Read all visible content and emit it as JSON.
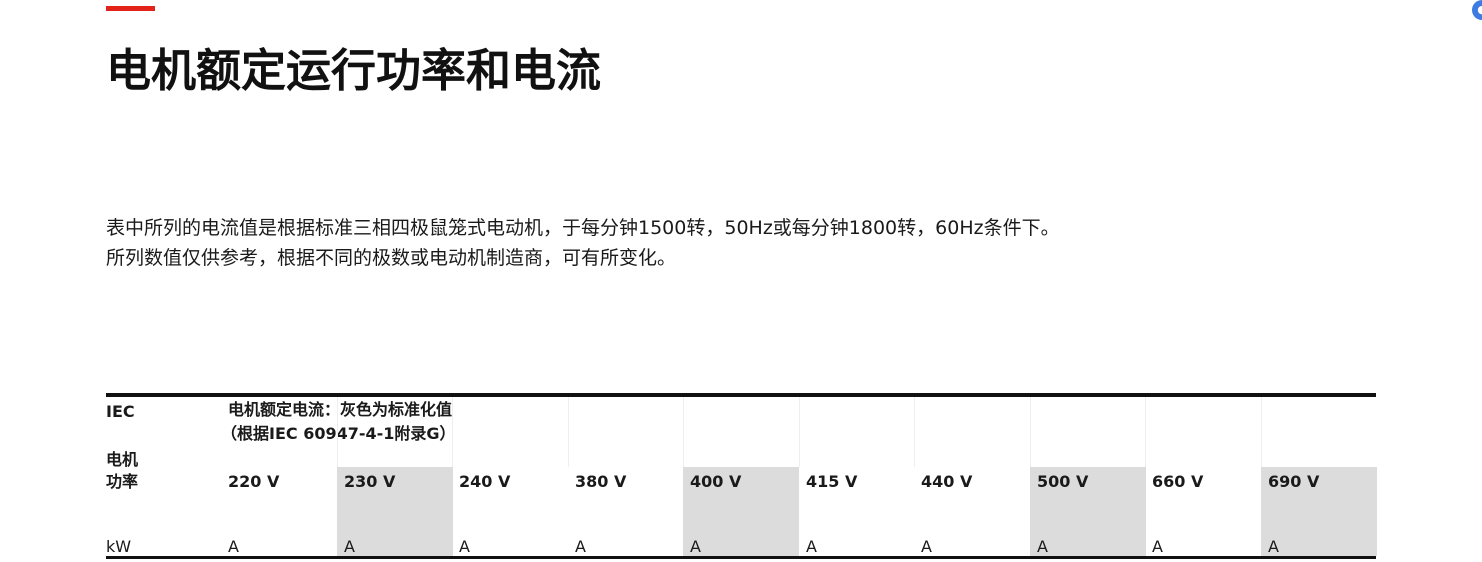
{
  "colors": {
    "accent": "#e2231a",
    "shade": "#dcdcdc"
  },
  "title": "电机额定运行功率和电流",
  "intro": {
    "line1": "表中所列的电流值是根据标准三相四极鼠笼式电动机，于每分钟1500转，50Hz或每分钟1800转，60Hz条件下。",
    "line2": "所列数值仅供参考，根据不同的极数或电动机制造商，可有所变化。"
  },
  "table": {
    "iec_label": "IEC",
    "motor_label_1": "电机",
    "motor_label_2": "功率",
    "current_header": "电机额定电流：灰色为标准化值",
    "current_note": "（根据IEC 60947-4-1附录G）",
    "power_unit": "kW",
    "columns": [
      {
        "voltage": "220 V",
        "unit": "A",
        "standard": false
      },
      {
        "voltage": "230 V",
        "unit": "A",
        "standard": true
      },
      {
        "voltage": "240 V",
        "unit": "A",
        "standard": false
      },
      {
        "voltage": "380 V",
        "unit": "A",
        "standard": false
      },
      {
        "voltage": "400 V",
        "unit": "A",
        "standard": true
      },
      {
        "voltage": "415 V",
        "unit": "A",
        "standard": false
      },
      {
        "voltage": "440 V",
        "unit": "A",
        "standard": false
      },
      {
        "voltage": "500 V",
        "unit": "A",
        "standard": true
      },
      {
        "voltage": "660 V",
        "unit": "A",
        "standard": false
      },
      {
        "voltage": "690 V",
        "unit": "A",
        "standard": true
      }
    ]
  }
}
